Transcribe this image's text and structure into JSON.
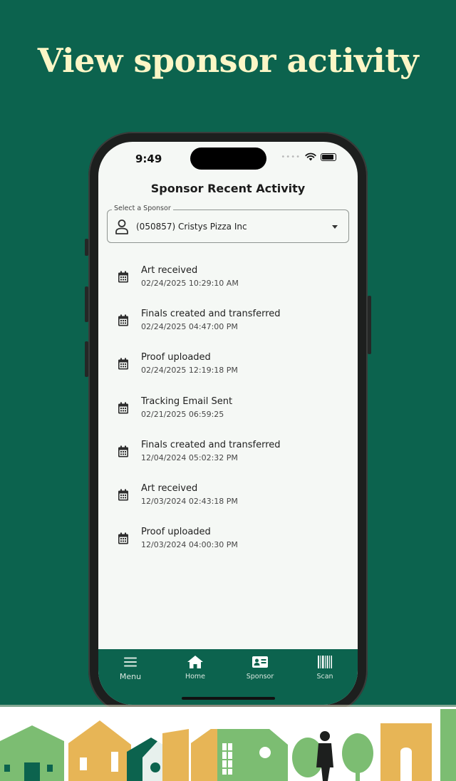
{
  "headline": "View sponsor activity",
  "status_bar": {
    "time": "9:49"
  },
  "screen": {
    "title": "Sponsor Recent Activity",
    "sponsor_select": {
      "legend": "Select a Sponsor",
      "value": "(050857) Cristys Pizza Inc"
    },
    "activities": [
      {
        "title": "Art received",
        "time": "02/24/2025 10:29:10 AM"
      },
      {
        "title": "Finals created and transferred",
        "time": "02/24/2025 04:47:00 PM"
      },
      {
        "title": "Proof uploaded",
        "time": "02/24/2025 12:19:18 PM"
      },
      {
        "title": "Tracking Email Sent",
        "time": "02/21/2025 06:59:25"
      },
      {
        "title": "Finals created and transferred",
        "time": "12/04/2024 05:02:32 PM"
      },
      {
        "title": "Art received",
        "time": "12/03/2024 02:43:18 PM"
      },
      {
        "title": "Proof uploaded",
        "time": "12/03/2024 04:00:30 PM"
      }
    ]
  },
  "bottom_nav": {
    "menu": "Menu",
    "home": "Home",
    "sponsor": "Sponsor",
    "scan": "Scan"
  },
  "colors": {
    "background": "#0c634e",
    "headline": "#fcf6c6",
    "screen": "#f5f8f5",
    "nav": "#0c634e"
  },
  "icons": [
    "user-icon",
    "calendar-icon",
    "menu-icon",
    "home-icon",
    "id-card-icon",
    "barcode-icon",
    "wifi-icon",
    "battery-icon"
  ]
}
